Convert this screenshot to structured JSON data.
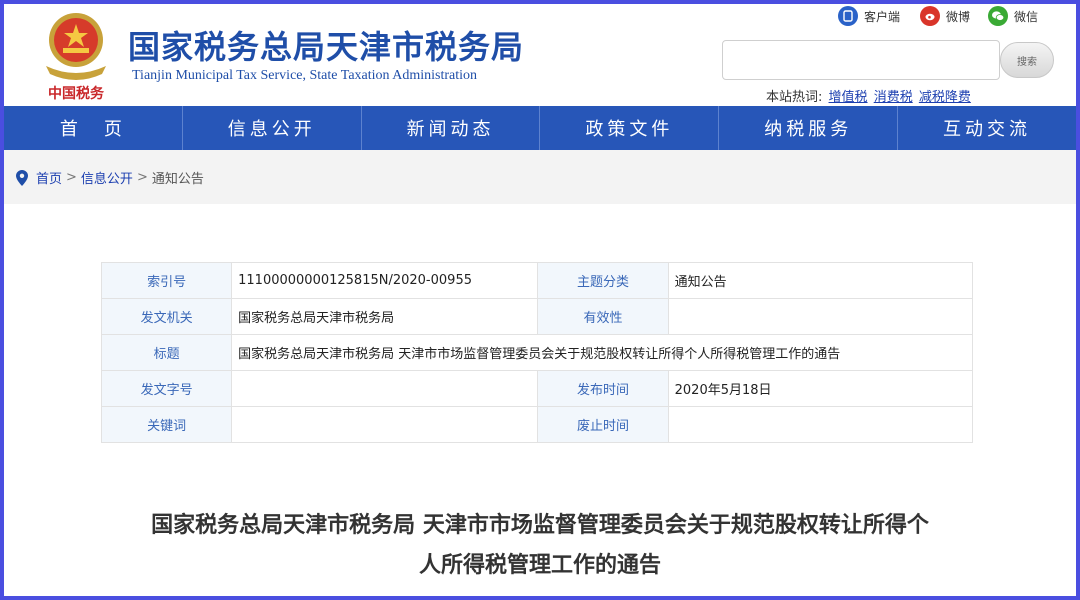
{
  "header": {
    "title": "国家税务总局天津市税务局",
    "subtitle": "Tianjin Municipal Tax Service, State Taxation Administration",
    "seal_text": "中国税务",
    "social": [
      {
        "label": "客户端",
        "icon": "client-icon",
        "color": "#2a62c8"
      },
      {
        "label": "微博",
        "icon": "weibo-icon",
        "color": "#d9352a"
      },
      {
        "label": "微信",
        "icon": "wechat-icon",
        "color": "#3aaa35"
      }
    ],
    "search": {
      "value": "",
      "placeholder": "",
      "button_label": "搜索"
    },
    "hotwords": {
      "label": "本站热词:",
      "items": [
        "增值税",
        "消费税",
        "减税降费"
      ]
    }
  },
  "nav": {
    "items": [
      "首　页",
      "信息公开",
      "新闻动态",
      "政策文件",
      "纳税服务",
      "互动交流"
    ],
    "color": "#2756b8"
  },
  "breadcrumb": {
    "items": [
      "首页",
      "信息公开",
      "通知公告"
    ],
    "separator": ">"
  },
  "info": {
    "index_label": "索引号",
    "index_value": "11100000000125815N/2020-00955",
    "topic_label": "主题分类",
    "topic_value": "通知公告",
    "issuer_label": "发文机关",
    "issuer_value": "国家税务总局天津市税务局",
    "validity_label": "有效性",
    "validity_value": "",
    "title_label": "标题",
    "title_value": "国家税务总局天津市税务局 天津市市场监督管理委员会关于规范股权转让所得个人所得税管理工作的通告",
    "docno_label": "发文字号",
    "docno_value": "",
    "date_label": "发布时间",
    "date_value": "2020年5月18日",
    "keyword_label": "关键词",
    "keyword_value": "",
    "abolish_label": "废止时间",
    "abolish_value": ""
  },
  "document": {
    "title_line1": "国家税务总局天津市税务局 天津市市场监督管理委员会关于规范股权转让所得个",
    "title_line2": "人所得税管理工作的通告"
  }
}
